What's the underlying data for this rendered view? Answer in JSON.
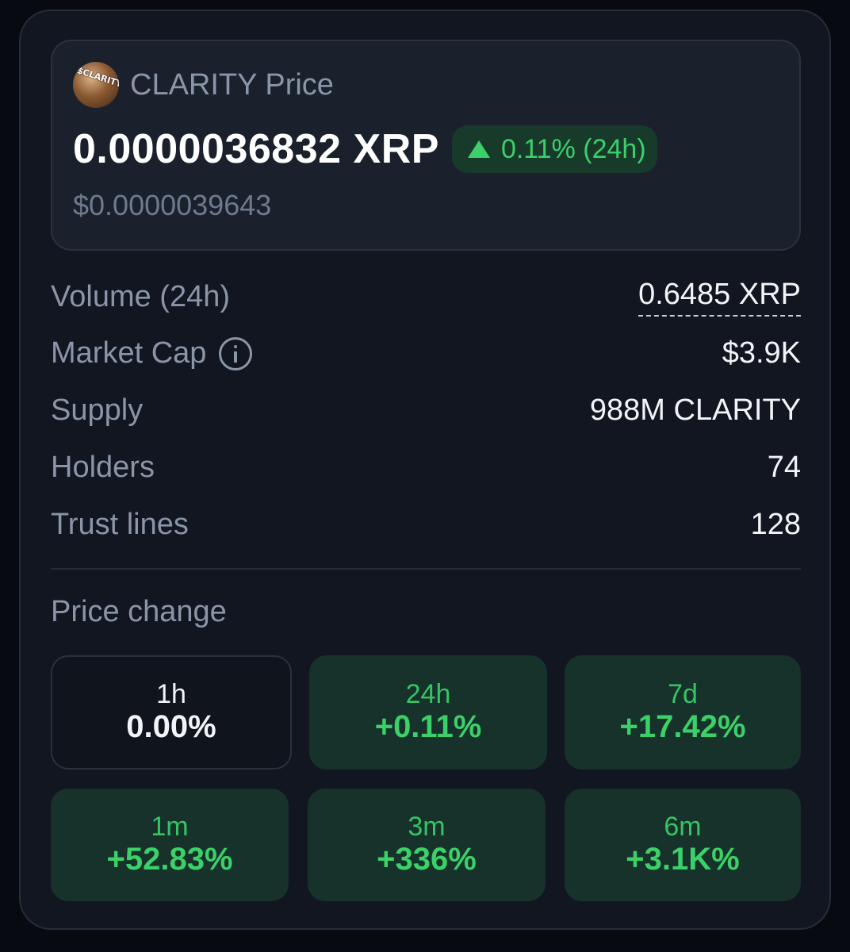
{
  "token": {
    "logo_text": "$CLARITY",
    "title": "CLARITY Price",
    "price_xrp": "0.0000036832 XRP",
    "change_24h": "0.11% (24h)",
    "price_usd": "$0.0000039643"
  },
  "stats": [
    {
      "label": "Volume (24h)",
      "value": "0.6485 XRP"
    },
    {
      "label": "Market Cap",
      "value": "$3.9K"
    },
    {
      "label": "Supply",
      "value": "988M CLARITY"
    },
    {
      "label": "Holders",
      "value": "74"
    },
    {
      "label": "Trust lines",
      "value": "128"
    }
  ],
  "price_change": {
    "title": "Price change",
    "periods": [
      {
        "period": "1h",
        "value": "0.00%"
      },
      {
        "period": "24h",
        "value": "+0.11%"
      },
      {
        "period": "7d",
        "value": "+17.42%"
      },
      {
        "period": "1m",
        "value": "+52.83%"
      },
      {
        "period": "3m",
        "value": "+336%"
      },
      {
        "period": "6m",
        "value": "+3.1K%"
      }
    ]
  },
  "colors": {
    "positive": "#3bd068",
    "positive_bg": "#16322a",
    "card_bg": "#111621"
  },
  "icons": [
    "token-logo",
    "triangle-up-icon",
    "info-icon"
  ]
}
